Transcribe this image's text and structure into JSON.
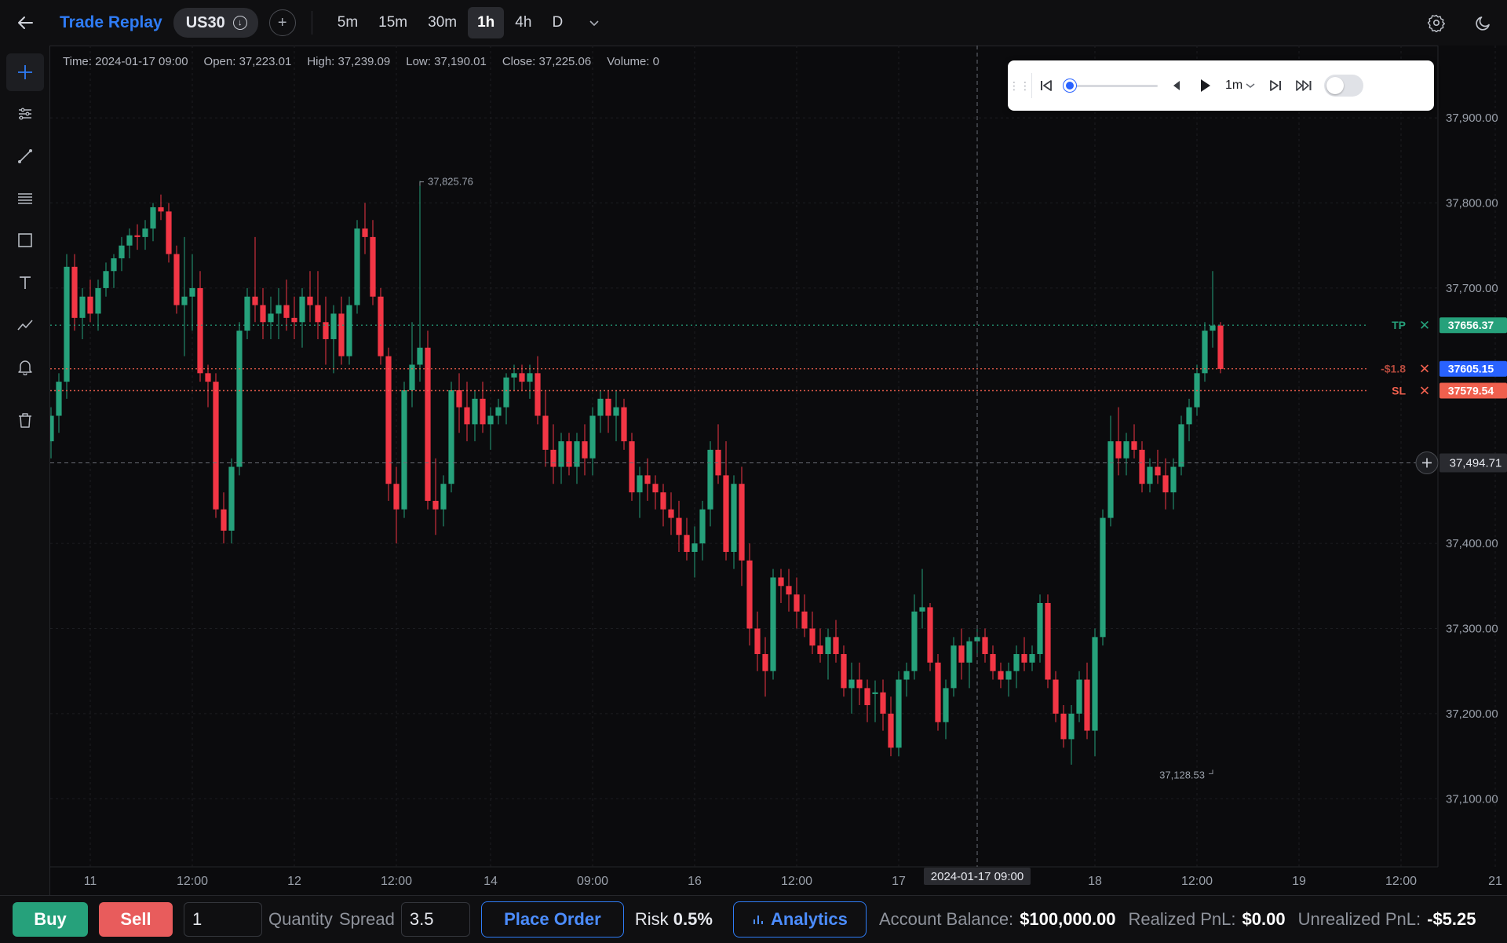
{
  "header": {
    "app_title": "Trade Replay",
    "symbol": "US30",
    "timeframes": [
      "5m",
      "15m",
      "30m",
      "1h",
      "4h",
      "D"
    ],
    "active_timeframe": "1h"
  },
  "ohlc": {
    "time": "Time: 2024-01-17 09:00",
    "open": "Open: 37,223.01",
    "high": "High: 37,239.09",
    "low": "Low: 37,190.01",
    "close": "Close: 37,225.06",
    "volume": "Volume: 0"
  },
  "replay": {
    "speed": "1m",
    "progress": 0.0,
    "autoplay_enabled": false
  },
  "colors": {
    "up": "#26a17b",
    "down": "#f23645",
    "accent": "#2f7cf6",
    "tp": "#26a17b",
    "sl": "#f0604e",
    "entry": "#2962ff"
  },
  "chart_data": {
    "type": "candlestick",
    "yticks": [
      "37,900.00",
      "37,800.00",
      "37,700.00",
      "37,400.00",
      "37,300.00",
      "37,200.00",
      "37,100.00"
    ],
    "ytick_values": [
      37900,
      37800,
      37700,
      37400,
      37300,
      37200,
      37100
    ],
    "ylim": [
      37020,
      37985
    ],
    "xticks": [
      "11",
      "12:00",
      "12",
      "12:00",
      "14",
      "09:00",
      "16",
      "12:00",
      "17",
      "18",
      "12:00",
      "19",
      "12:00",
      "21"
    ],
    "xtick_index": [
      5,
      18,
      31,
      44,
      56,
      69,
      82,
      95,
      108,
      133,
      146,
      159,
      172,
      184
    ],
    "crosshair": {
      "index": 118,
      "price": 37494.71,
      "label": "37,494.71",
      "time_label": "2024-01-17 09:00"
    },
    "annotations": [
      {
        "label": "37,825.76",
        "index": 47,
        "price": 37825.76
      },
      {
        "label": "37,128.53",
        "index": 148,
        "price": 37128.53
      }
    ],
    "lines": {
      "tp": {
        "label": "TP",
        "price": 37656.37,
        "text": "37656.37"
      },
      "entry": {
        "label": "-$1.8",
        "price": 37605.15,
        "text": "37605.15"
      },
      "sl": {
        "label": "SL",
        "price": 37579.54,
        "text": "37579.54"
      }
    },
    "candles": [
      [
        37520,
        37560,
        37500,
        37550
      ],
      [
        37550,
        37600,
        37530,
        37590
      ],
      [
        37590,
        37740,
        37570,
        37725
      ],
      [
        37725,
        37740,
        37650,
        37665
      ],
      [
        37665,
        37700,
        37640,
        37690
      ],
      [
        37690,
        37710,
        37660,
        37670
      ],
      [
        37670,
        37710,
        37650,
        37700
      ],
      [
        37700,
        37730,
        37690,
        37720
      ],
      [
        37720,
        37740,
        37700,
        37735
      ],
      [
        37735,
        37760,
        37720,
        37750
      ],
      [
        37750,
        37770,
        37735,
        37762
      ],
      [
        37762,
        37775,
        37745,
        37760
      ],
      [
        37760,
        37780,
        37745,
        37770
      ],
      [
        37770,
        37800,
        37755,
        37795
      ],
      [
        37795,
        37810,
        37780,
        37790
      ],
      [
        37790,
        37800,
        37730,
        37740
      ],
      [
        37740,
        37750,
        37670,
        37680
      ],
      [
        37680,
        37760,
        37620,
        37690
      ],
      [
        37690,
        37740,
        37650,
        37700
      ],
      [
        37700,
        37720,
        37590,
        37600
      ],
      [
        37600,
        37610,
        37560,
        37590
      ],
      [
        37590,
        37600,
        37430,
        37440
      ],
      [
        37440,
        37460,
        37400,
        37415
      ],
      [
        37415,
        37500,
        37400,
        37490
      ],
      [
        37490,
        37660,
        37480,
        37650
      ],
      [
        37650,
        37700,
        37640,
        37690
      ],
      [
        37690,
        37760,
        37660,
        37680
      ],
      [
        37680,
        37700,
        37640,
        37660
      ],
      [
        37660,
        37690,
        37640,
        37670
      ],
      [
        37670,
        37700,
        37640,
        37680
      ],
      [
        37680,
        37710,
        37650,
        37665
      ],
      [
        37665,
        37690,
        37640,
        37660
      ],
      [
        37660,
        37700,
        37630,
        37690
      ],
      [
        37690,
        37720,
        37660,
        37680
      ],
      [
        37680,
        37720,
        37640,
        37660
      ],
      [
        37660,
        37690,
        37610,
        37640
      ],
      [
        37640,
        37680,
        37600,
        37670
      ],
      [
        37670,
        37690,
        37610,
        37620
      ],
      [
        37620,
        37690,
        37610,
        37680
      ],
      [
        37680,
        37780,
        37670,
        37770
      ],
      [
        37770,
        37800,
        37740,
        37760
      ],
      [
        37760,
        37780,
        37680,
        37690
      ],
      [
        37690,
        37700,
        37610,
        37620
      ],
      [
        37620,
        37630,
        37450,
        37470
      ],
      [
        37470,
        37490,
        37400,
        37440
      ],
      [
        37440,
        37590,
        37430,
        37580
      ],
      [
        37580,
        37660,
        37560,
        37610
      ],
      [
        37610,
        37826,
        37590,
        37630
      ],
      [
        37630,
        37650,
        37440,
        37450
      ],
      [
        37450,
        37500,
        37410,
        37440
      ],
      [
        37440,
        37480,
        37420,
        37470
      ],
      [
        37470,
        37590,
        37460,
        37580
      ],
      [
        37580,
        37600,
        37530,
        37560
      ],
      [
        37560,
        37590,
        37520,
        37540
      ],
      [
        37540,
        37580,
        37520,
        37570
      ],
      [
        37570,
        37590,
        37530,
        37540
      ],
      [
        37540,
        37560,
        37510,
        37550
      ],
      [
        37550,
        37570,
        37540,
        37560
      ],
      [
        37560,
        37600,
        37540,
        37595
      ],
      [
        37595,
        37610,
        37580,
        37600
      ],
      [
        37600,
        37610,
        37580,
        37590
      ],
      [
        37590,
        37610,
        37570,
        37600
      ],
      [
        37600,
        37620,
        37540,
        37550
      ],
      [
        37550,
        37580,
        37490,
        37510
      ],
      [
        37510,
        37540,
        37470,
        37490
      ],
      [
        37490,
        37530,
        37470,
        37520
      ],
      [
        37520,
        37530,
        37480,
        37490
      ],
      [
        37490,
        37530,
        37470,
        37520
      ],
      [
        37520,
        37540,
        37480,
        37500
      ],
      [
        37500,
        37560,
        37480,
        37550
      ],
      [
        37550,
        37580,
        37530,
        37570
      ],
      [
        37570,
        37580,
        37530,
        37550
      ],
      [
        37550,
        37580,
        37520,
        37560
      ],
      [
        37560,
        37570,
        37510,
        37520
      ],
      [
        37520,
        37530,
        37450,
        37460
      ],
      [
        37460,
        37490,
        37430,
        37480
      ],
      [
        37480,
        37500,
        37450,
        37470
      ],
      [
        37470,
        37480,
        37440,
        37460
      ],
      [
        37460,
        37470,
        37420,
        37440
      ],
      [
        37440,
        37460,
        37410,
        37430
      ],
      [
        37430,
        37450,
        37390,
        37410
      ],
      [
        37410,
        37430,
        37380,
        37390
      ],
      [
        37390,
        37420,
        37360,
        37400
      ],
      [
        37400,
        37450,
        37380,
        37440
      ],
      [
        37440,
        37520,
        37420,
        37510
      ],
      [
        37510,
        37540,
        37470,
        37480
      ],
      [
        37480,
        37520,
        37380,
        37390
      ],
      [
        37390,
        37480,
        37370,
        37470
      ],
      [
        37470,
        37490,
        37350,
        37380
      ],
      [
        37380,
        37400,
        37280,
        37300
      ],
      [
        37300,
        37320,
        37250,
        37270
      ],
      [
        37270,
        37290,
        37220,
        37250
      ],
      [
        37250,
        37370,
        37240,
        37360
      ],
      [
        37360,
        37370,
        37330,
        37350
      ],
      [
        37350,
        37370,
        37320,
        37340
      ],
      [
        37340,
        37360,
        37300,
        37320
      ],
      [
        37320,
        37340,
        37290,
        37300
      ],
      [
        37300,
        37320,
        37270,
        37280
      ],
      [
        37280,
        37300,
        37260,
        37270
      ],
      [
        37270,
        37300,
        37240,
        37290
      ],
      [
        37290,
        37310,
        37260,
        37270
      ],
      [
        37270,
        37280,
        37220,
        37230
      ],
      [
        37230,
        37260,
        37200,
        37240
      ],
      [
        37240,
        37260,
        37210,
        37230
      ],
      [
        37230,
        37240,
        37190,
        37210
      ],
      [
        37223,
        37239,
        37190,
        37225
      ],
      [
        37225,
        37240,
        37180,
        37200
      ],
      [
        37200,
        37220,
        37150,
        37160
      ],
      [
        37160,
        37250,
        37150,
        37240
      ],
      [
        37240,
        37260,
        37220,
        37250
      ],
      [
        37250,
        37340,
        37240,
        37320
      ],
      [
        37320,
        37370,
        37300,
        37325
      ],
      [
        37325,
        37330,
        37250,
        37260
      ],
      [
        37260,
        37270,
        37180,
        37190
      ],
      [
        37190,
        37240,
        37170,
        37230
      ],
      [
        37230,
        37290,
        37220,
        37280
      ],
      [
        37280,
        37300,
        37240,
        37260
      ],
      [
        37260,
        37290,
        37230,
        37285
      ],
      [
        37285,
        37300,
        37270,
        37290
      ],
      [
        37290,
        37300,
        37260,
        37270
      ],
      [
        37270,
        37280,
        37240,
        37250
      ],
      [
        37250,
        37260,
        37230,
        37240
      ],
      [
        37240,
        37260,
        37220,
        37250
      ],
      [
        37250,
        37280,
        37230,
        37270
      ],
      [
        37270,
        37290,
        37250,
        37260
      ],
      [
        37260,
        37280,
        37250,
        37270
      ],
      [
        37270,
        37340,
        37260,
        37330
      ],
      [
        37330,
        37340,
        37230,
        37240
      ],
      [
        37240,
        37250,
        37190,
        37200
      ],
      [
        37200,
        37210,
        37160,
        37170
      ],
      [
        37170,
        37210,
        37140,
        37200
      ],
      [
        37200,
        37250,
        37190,
        37240
      ],
      [
        37240,
        37260,
        37170,
        37180
      ],
      [
        37180,
        37300,
        37150,
        37290
      ],
      [
        37290,
        37440,
        37280,
        37430
      ],
      [
        37430,
        37550,
        37420,
        37520
      ],
      [
        37520,
        37560,
        37480,
        37500
      ],
      [
        37500,
        37530,
        37480,
        37520
      ],
      [
        37520,
        37540,
        37500,
        37510
      ],
      [
        37510,
        37520,
        37460,
        37470
      ],
      [
        37470,
        37500,
        37460,
        37490
      ],
      [
        37490,
        37510,
        37470,
        37480
      ],
      [
        37480,
        37500,
        37440,
        37460
      ],
      [
        37460,
        37500,
        37440,
        37490
      ],
      [
        37490,
        37550,
        37480,
        37540
      ],
      [
        37540,
        37570,
        37520,
        37560
      ],
      [
        37560,
        37610,
        37550,
        37600
      ],
      [
        37600,
        37660,
        37590,
        37650
      ],
      [
        37650,
        37720,
        37630,
        37656
      ],
      [
        37656,
        37660,
        37600,
        37605
      ]
    ]
  },
  "order": {
    "buy_label": "Buy",
    "sell_label": "Sell",
    "quantity_value": "1",
    "quantity_label": "Quantity",
    "spread_label": "Spread",
    "spread_value": "3.5",
    "place_order_label": "Place Order",
    "risk_label": "Risk",
    "risk_value": "0.5%",
    "analytics_label": "Analytics",
    "account_balance_label": "Account Balance:",
    "account_balance_value": "$100,000.00",
    "realized_pnl_label": "Realized PnL:",
    "realized_pnl_value": "$0.00",
    "unrealized_pnl_label": "Unrealized PnL:",
    "unrealized_pnl_value": "-$5.25"
  }
}
